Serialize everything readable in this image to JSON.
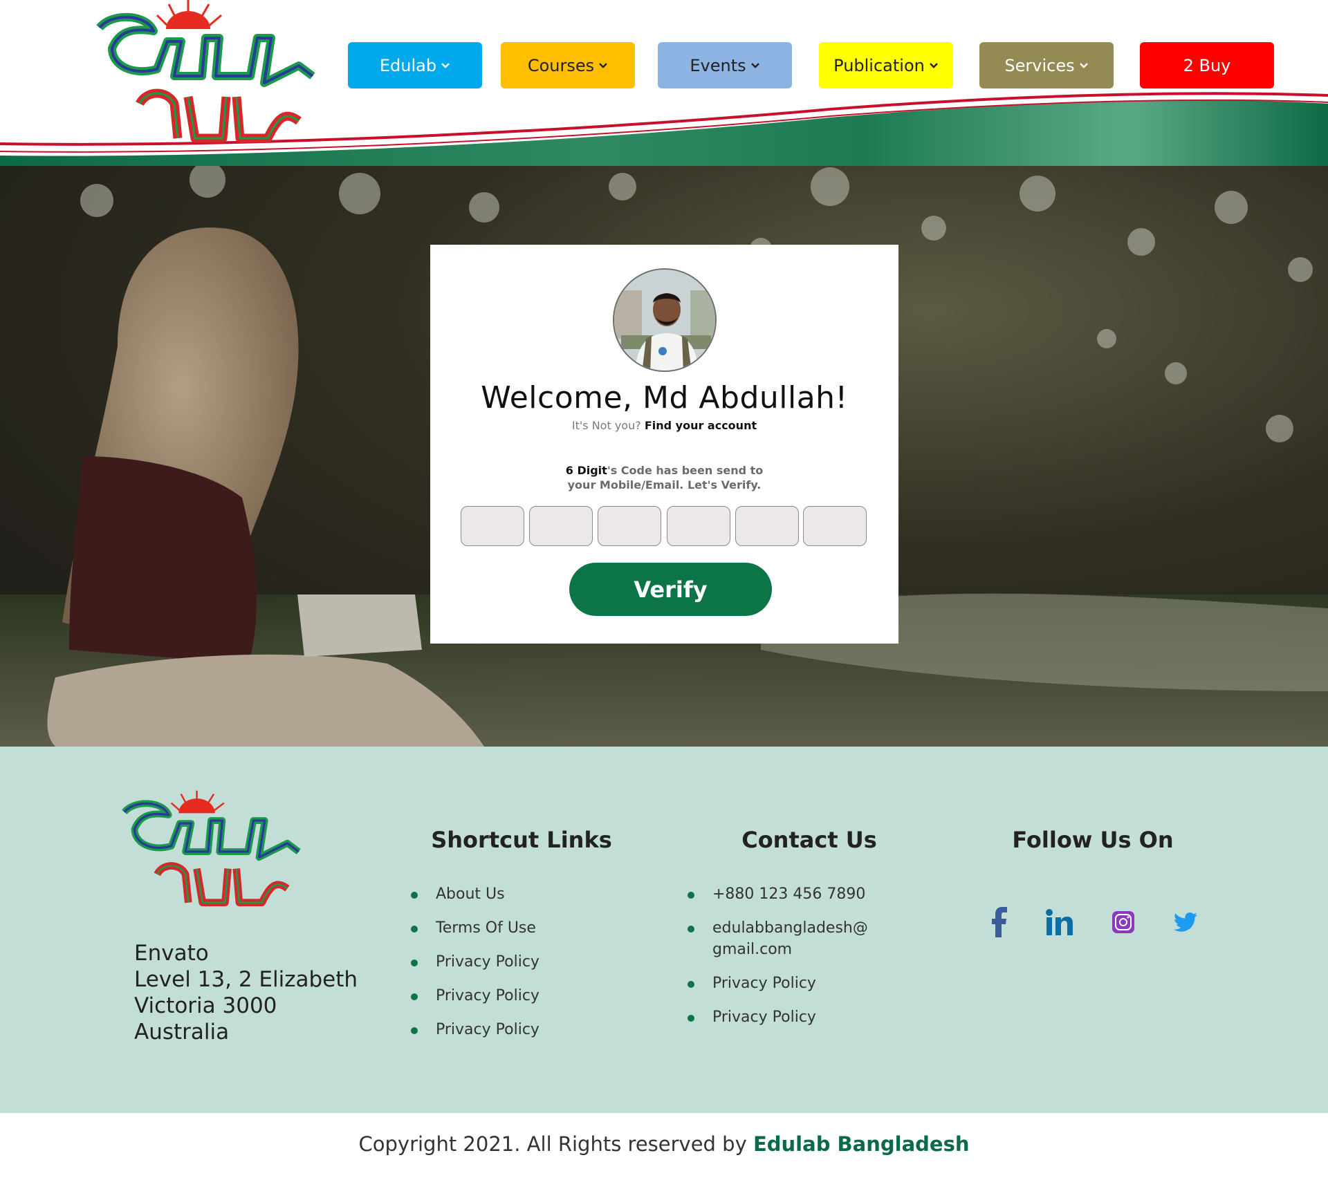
{
  "header": {
    "logo_alt": "এডুল্যাব বাংলাদেশ",
    "nav": [
      {
        "label": "Edulab",
        "dropdown": true,
        "bg": "#00a8ec",
        "color": "#ffffff"
      },
      {
        "label": "Courses",
        "dropdown": true,
        "bg": "#ffbf00",
        "color": "#222222"
      },
      {
        "label": "Events",
        "dropdown": true,
        "bg": "#8eb4e3",
        "color": "#222222"
      },
      {
        "label": "Publication",
        "dropdown": true,
        "bg": "#ffff00",
        "color": "#222222"
      },
      {
        "label": "Services",
        "dropdown": true,
        "bg": "#948a54",
        "color": "#ffffff"
      },
      {
        "label": "2 Buy",
        "dropdown": false,
        "bg": "#ff0000",
        "color": "#ffffff"
      }
    ]
  },
  "card": {
    "welcome": "Welcome, Md Abdullah!",
    "not_you": "It's Not you?",
    "find_account": "Find your account",
    "digit_strong": "6 Digit",
    "code_line1_rest": "'s Code has been send to",
    "code_line2": "your Mobile/Email. Let's Verify.",
    "otp_fields": [
      "",
      "",
      "",
      "",
      "",
      ""
    ],
    "verify_label": "Verify"
  },
  "footer": {
    "address": [
      "Envato",
      "Level 13, 2 Elizabeth",
      "Victoria 3000",
      "Australia"
    ],
    "shortcut_title": "Shortcut Links",
    "shortcut_links": [
      "About Us",
      "Terms Of Use",
      "Privacy Policy",
      "Privacy Policy",
      "Privacy Policy"
    ],
    "contact_title": "Contact Us",
    "contact_phone": "+880 123 456 7890",
    "contact_email_1": "edulabbangladesh@",
    "contact_email_2": "gmail.com",
    "contact_links": [
      "Privacy Policy",
      "Privacy Policy"
    ],
    "follow_title": "Follow Us On",
    "social_icons": [
      "facebook-icon",
      "linkedin-icon",
      "instagram-icon",
      "twitter-icon"
    ]
  },
  "copyright": {
    "text": "Copyright 2021. All Rights reserved by",
    "brand": "Edulab Bangladesh"
  }
}
